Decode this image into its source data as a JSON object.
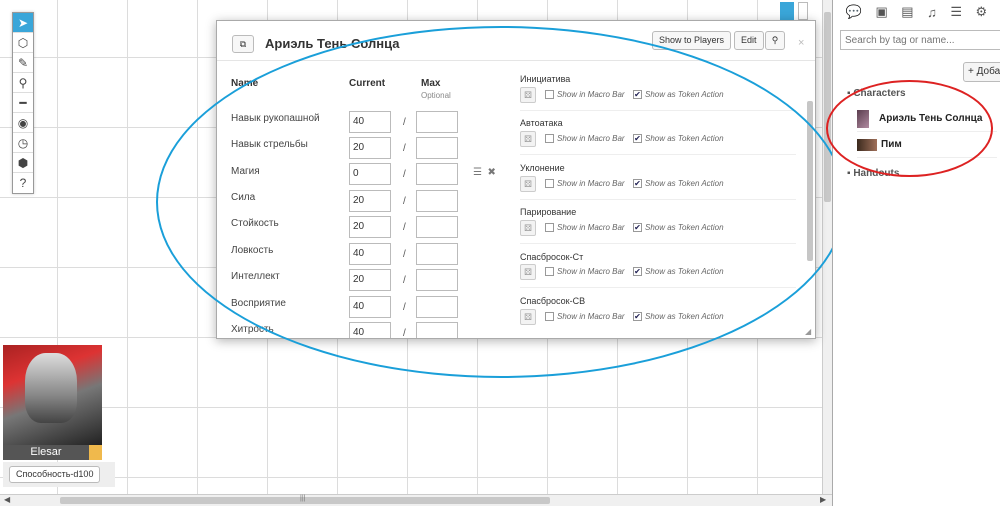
{
  "sidebar": {
    "tabs": [
      "chat-icon",
      "art-icon",
      "journal-icon",
      "jukebox-icon",
      "decks-icon",
      "settings-icon"
    ],
    "search_placeholder": "Search by tag or name...",
    "add_label": "+ Доба",
    "section_characters": "Characters",
    "section_handouts": "Handouts",
    "items": [
      {
        "label": "Ариэль Тень Солнца"
      },
      {
        "label": "Пим"
      }
    ]
  },
  "dialog": {
    "title": "Ариэль Тень Солнца",
    "show_to_players": "Show to Players",
    "edit": "Edit",
    "close": "×",
    "headers": {
      "name": "Name",
      "current": "Current",
      "max": "Max",
      "optional": "Optional"
    },
    "attributes": [
      {
        "name": "Навык рукопашной",
        "current": "40"
      },
      {
        "name": "Навык стрельбы",
        "current": "20"
      },
      {
        "name": "Магия",
        "current": "0"
      },
      {
        "name": "Сила",
        "current": "20"
      },
      {
        "name": "Стойкость",
        "current": "20"
      },
      {
        "name": "Ловкость",
        "current": "40"
      },
      {
        "name": "Интеллект",
        "current": "20"
      },
      {
        "name": "Восприятие",
        "current": "40"
      },
      {
        "name": "Хитрость",
        "current": "40"
      }
    ],
    "slash": "/",
    "abilities": [
      {
        "name": "Инициатива"
      },
      {
        "name": "Автоатака"
      },
      {
        "name": "Уклонение"
      },
      {
        "name": "Парирование"
      },
      {
        "name": "Спасбросок-Ст"
      },
      {
        "name": "Спасбросок-СВ"
      }
    ],
    "show_in_macro_bar": "Show in Macro Bar",
    "show_as_token_action": "Show as Token Action"
  },
  "token": {
    "name": "Elesar"
  },
  "macro_bar": {
    "button": "Способность-d100"
  },
  "colors": {
    "accent": "#3aa6d9",
    "annotation_blue": "#1a9fd9",
    "annotation_red": "#dd2222"
  }
}
